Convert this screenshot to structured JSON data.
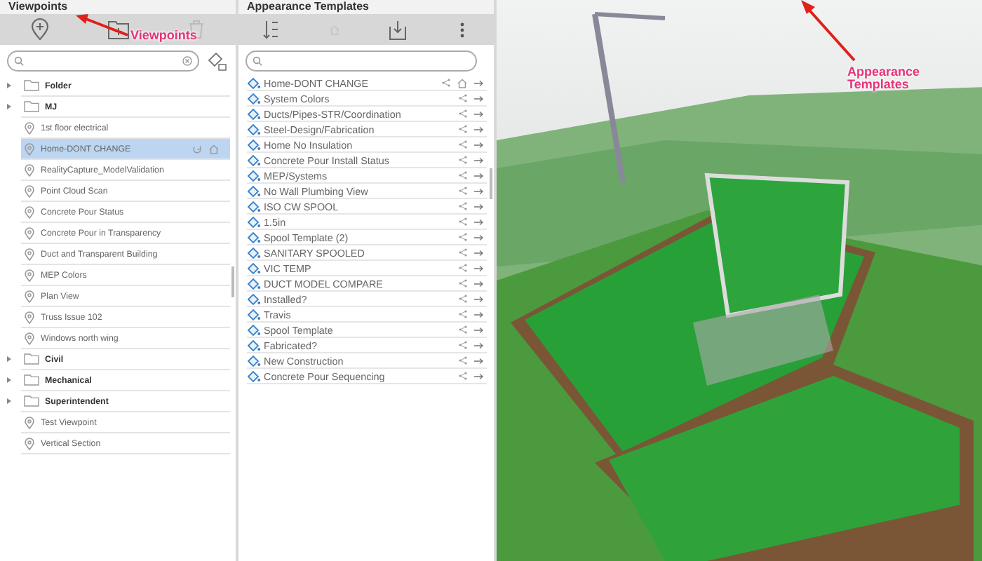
{
  "viewpoints_panel": {
    "title": "Viewpoints",
    "items": [
      {
        "kind": "folder",
        "label": "Folder",
        "selected": false
      },
      {
        "kind": "folder",
        "label": "MJ",
        "selected": false
      },
      {
        "kind": "viewpoint",
        "label": "1st floor electrical",
        "selected": false
      },
      {
        "kind": "viewpoint",
        "label": "Home-DONT CHANGE",
        "selected": true,
        "home": true
      },
      {
        "kind": "viewpoint",
        "label": "RealityCapture_ModelValidation",
        "selected": false
      },
      {
        "kind": "viewpoint",
        "label": "Point Cloud Scan",
        "selected": false
      },
      {
        "kind": "viewpoint",
        "label": "Concrete Pour Status",
        "selected": false
      },
      {
        "kind": "viewpoint",
        "label": "Concrete Pour in Transparency",
        "selected": false
      },
      {
        "kind": "viewpoint",
        "label": "Duct and Transparent Building",
        "selected": false
      },
      {
        "kind": "viewpoint",
        "label": "MEP Colors",
        "selected": false
      },
      {
        "kind": "viewpoint",
        "label": "Plan View",
        "selected": false
      },
      {
        "kind": "viewpoint",
        "label": "Truss Issue 102",
        "selected": false
      },
      {
        "kind": "viewpoint",
        "label": "Windows north wing",
        "selected": false
      },
      {
        "kind": "folder",
        "label": "Civil",
        "selected": false
      },
      {
        "kind": "folder",
        "label": "Mechanical",
        "selected": false
      },
      {
        "kind": "folder",
        "label": "Superintendent",
        "selected": false
      },
      {
        "kind": "viewpoint",
        "label": "Test Viewpoint",
        "selected": false
      },
      {
        "kind": "viewpoint",
        "label": "Vertical Section",
        "selected": false
      }
    ]
  },
  "templates_panel": {
    "title": "Appearance Templates",
    "items": [
      {
        "label": "Home-DONT CHANGE",
        "home": true
      },
      {
        "label": "System Colors",
        "home": false
      },
      {
        "label": "Ducts/Pipes-STR/Coordination",
        "home": false
      },
      {
        "label": "Steel-Design/Fabrication",
        "home": false
      },
      {
        "label": "Home No Insulation",
        "home": false
      },
      {
        "label": "Concrete Pour Install Status",
        "home": false
      },
      {
        "label": "MEP/Systems",
        "home": false
      },
      {
        "label": "No Wall Plumbing View",
        "home": false
      },
      {
        "label": "ISO CW SPOOL",
        "home": false
      },
      {
        "label": "1.5in",
        "home": false
      },
      {
        "label": "Spool Template (2)",
        "home": false
      },
      {
        "label": "SANITARY SPOOLED",
        "home": false
      },
      {
        "label": "VIC TEMP",
        "home": false
      },
      {
        "label": "DUCT MODEL COMPARE",
        "home": false
      },
      {
        "label": "Installed?",
        "home": false
      },
      {
        "label": "Travis",
        "home": false
      },
      {
        "label": "Spool Template",
        "home": false
      },
      {
        "label": "Fabricated?",
        "home": false
      },
      {
        "label": "New Construction",
        "home": false
      },
      {
        "label": "Concrete Pour Sequencing",
        "home": false
      }
    ]
  },
  "annotations": [
    {
      "label": "Viewpoints"
    },
    {
      "label": "Appearance Templates"
    }
  ]
}
